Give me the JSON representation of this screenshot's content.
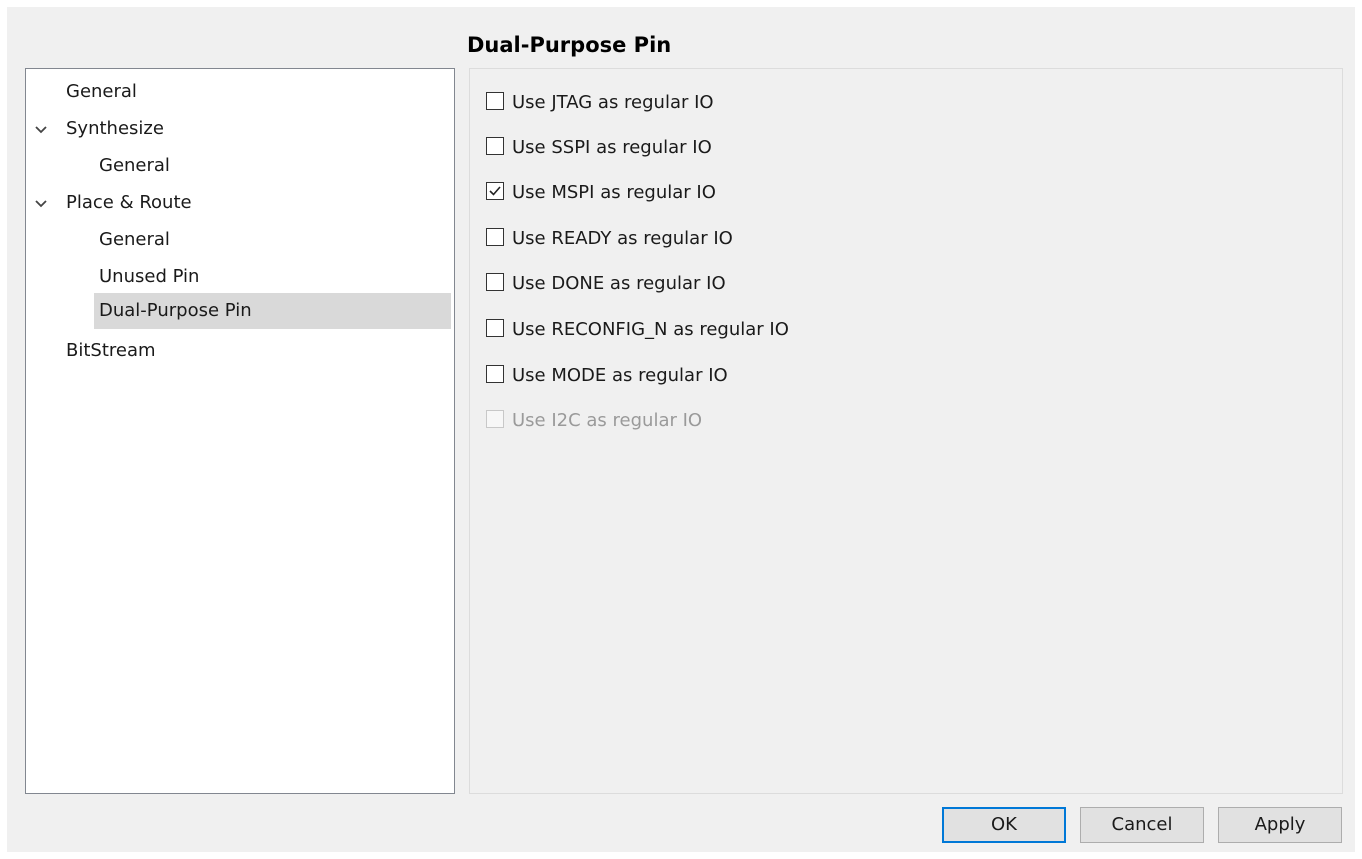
{
  "title": "Dual-Purpose Pin",
  "tree": {
    "items": [
      {
        "label": "General",
        "level": 0,
        "expandable": false,
        "selected": false
      },
      {
        "label": "Synthesize",
        "level": 0,
        "expandable": true,
        "selected": false
      },
      {
        "label": "General",
        "level": 1,
        "expandable": false,
        "selected": false
      },
      {
        "label": "Place & Route",
        "level": 0,
        "expandable": true,
        "selected": false
      },
      {
        "label": "General",
        "level": 1,
        "expandable": false,
        "selected": false
      },
      {
        "label": "Unused Pin",
        "level": 1,
        "expandable": false,
        "selected": false
      },
      {
        "label": "Dual-Purpose Pin",
        "level": 1,
        "expandable": false,
        "selected": true
      },
      {
        "label": "BitStream",
        "level": 0,
        "expandable": false,
        "selected": false
      }
    ]
  },
  "options": [
    {
      "label": "Use JTAG as regular IO",
      "checked": false,
      "enabled": true
    },
    {
      "label": "Use SSPI as regular IO",
      "checked": false,
      "enabled": true
    },
    {
      "label": "Use MSPI as regular IO",
      "checked": true,
      "enabled": true
    },
    {
      "label": "Use READY as regular IO",
      "checked": false,
      "enabled": true
    },
    {
      "label": "Use DONE as regular IO",
      "checked": false,
      "enabled": true
    },
    {
      "label": "Use RECONFIG_N as regular IO",
      "checked": false,
      "enabled": true
    },
    {
      "label": "Use MODE as regular IO",
      "checked": false,
      "enabled": true
    },
    {
      "label": "Use I2C as regular IO",
      "checked": false,
      "enabled": false
    }
  ],
  "buttons": {
    "ok": "OK",
    "cancel": "Cancel",
    "apply": "Apply"
  },
  "colors": {
    "selection": "#d9d9d9",
    "default_button_border": "#0078d7"
  },
  "icons": {
    "expand": "chevron-down-icon",
    "check": "checkmark-icon"
  }
}
